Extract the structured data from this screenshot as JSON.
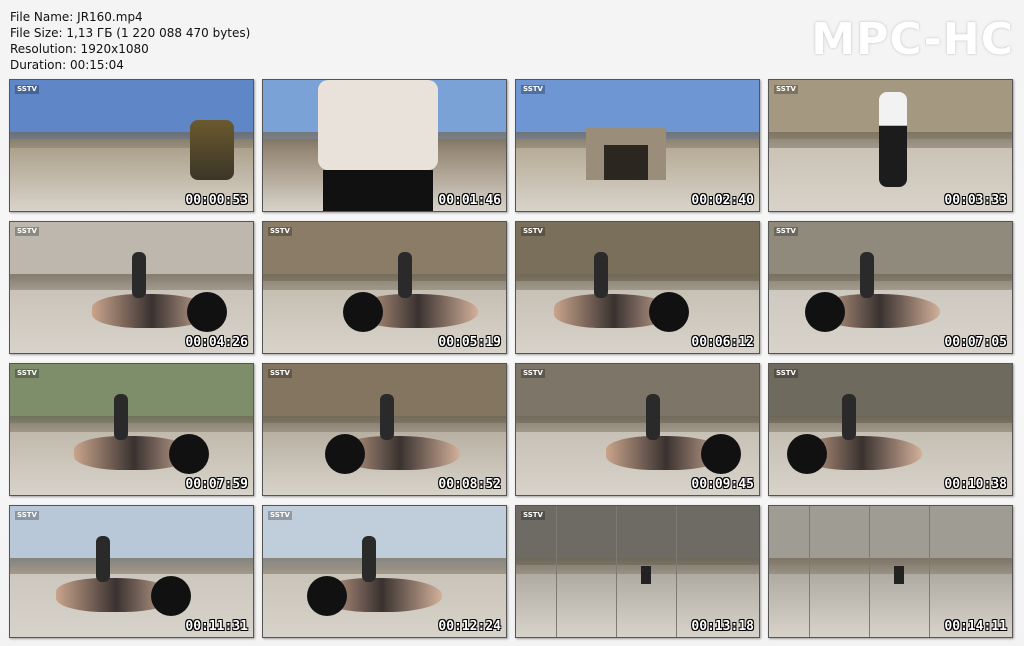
{
  "file_info": {
    "name_line": "File Name: JR160.mp4",
    "size_line": "File Size: 1,13 ГБ (1 220 088 470 bytes)",
    "resolution_line": "Resolution: 1920x1080",
    "duration_line": "Duration: 00:15:04"
  },
  "logo": "MPC-HC",
  "thumbnails": [
    {
      "time": "00:00:53",
      "wm": "SSTV",
      "scene": "robot",
      "sky": "#5f86c6",
      "ground": "#a79a84"
    },
    {
      "time": "00:01:46",
      "wm": "",
      "scene": "closeup",
      "sky": "#7aa2d6",
      "ground": "#8a7a66"
    },
    {
      "time": "00:02:40",
      "wm": "SSTV",
      "scene": "building",
      "sky": "#6e96d2",
      "ground": "#b2a690"
    },
    {
      "time": "00:03:33",
      "wm": "SSTV",
      "scene": "indoor",
      "sky": "#a59880",
      "ground": "#c9c0b2"
    },
    {
      "time": "00:04:26",
      "wm": "SSTV",
      "scene": "lying",
      "sky": "#bdb7ad",
      "ground": "#c7c1b7"
    },
    {
      "time": "00:05:19",
      "wm": "SSTV",
      "scene": "lying",
      "sky": "#8a7c66",
      "ground": "#c3bcaf"
    },
    {
      "time": "00:06:12",
      "wm": "SSTV",
      "scene": "lying",
      "sky": "#7a6f5b",
      "ground": "#c4beb2"
    },
    {
      "time": "00:07:05",
      "wm": "SSTV",
      "scene": "lying",
      "sky": "#8f8a7c",
      "ground": "#cdc8bf"
    },
    {
      "time": "00:07:59",
      "wm": "SSTV",
      "scene": "lying",
      "sky": "#7f8e6a",
      "ground": "#bdb6a8"
    },
    {
      "time": "00:08:52",
      "wm": "SSTV",
      "scene": "lying",
      "sky": "#837560",
      "ground": "#b3ab9c"
    },
    {
      "time": "00:09:45",
      "wm": "SSTV",
      "scene": "lying",
      "sky": "#7d7668",
      "ground": "#c4beb3"
    },
    {
      "time": "00:10:38",
      "wm": "SSTV",
      "scene": "lying",
      "sky": "#6f6a5e",
      "ground": "#c2bcb0"
    },
    {
      "time": "00:11:31",
      "wm": "SSTV",
      "scene": "lying",
      "sky": "#b8c8d8",
      "ground": "#cbc6bd"
    },
    {
      "time": "00:12:24",
      "wm": "SSTV",
      "scene": "lying",
      "sky": "#c0cedc",
      "ground": "#c7c1b6"
    },
    {
      "time": "00:13:18",
      "wm": "SSTV",
      "scene": "concrete",
      "sky": "#6d6b63",
      "ground": "#a9a59d"
    },
    {
      "time": "00:14:11",
      "wm": "",
      "scene": "concrete",
      "sky": "#9f9c94",
      "ground": "#a8a59d"
    }
  ]
}
